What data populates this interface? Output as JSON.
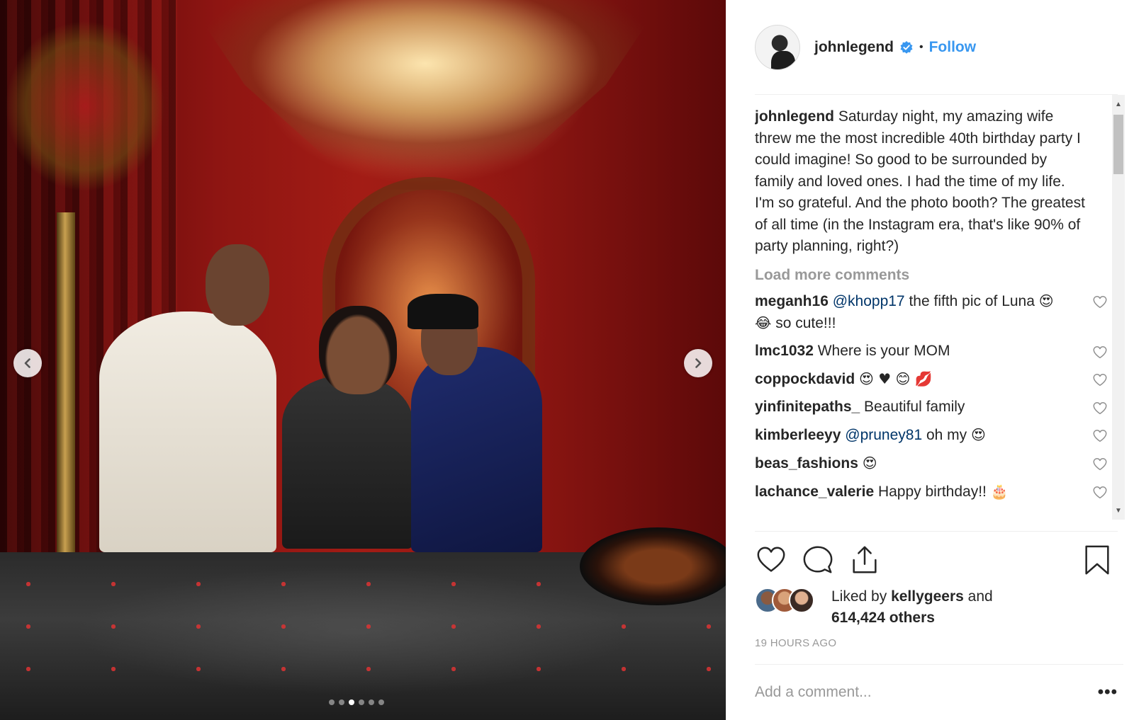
{
  "post": {
    "username": "johnlegend",
    "separator": "•",
    "follow_label": "Follow",
    "caption": "Saturday night, my amazing wife threw me the most incredible 40th birthday party I could imagine! So good to be surrounded by family and loved ones. I had the time of my life. I'm so grateful. And the photo booth? The greatest of all time (in the Instagram era, that's like 90% of party planning, right?)",
    "load_more": "Load more comments",
    "comments": [
      {
        "user": "meganh16",
        "mention": "@khopp17",
        "text": " the fifth pic of Luna ",
        "emoji": "😍 😂",
        "tail": " so cute!!!"
      },
      {
        "user": "lmc1032",
        "mention": "",
        "text": " Where is your MOM",
        "emoji": "",
        "tail": ""
      },
      {
        "user": "coppockdavid",
        "mention": "",
        "text": " ",
        "emoji": "😍 ♥ 😊 💋",
        "tail": ""
      },
      {
        "user": "yinfinitepaths_",
        "mention": "",
        "text": " Beautiful family",
        "emoji": "",
        "tail": ""
      },
      {
        "user": "kimberleeyy",
        "mention": "@pruney81",
        "text": " oh my ",
        "emoji": "😍",
        "tail": ""
      },
      {
        "user": "beas_fashions",
        "mention": "",
        "text": " ",
        "emoji": "😍",
        "tail": ""
      },
      {
        "user": "lachance_valerie",
        "mention": "",
        "text": " Happy birthday!! ",
        "emoji": "🎂",
        "tail": ""
      }
    ],
    "liked_by_prefix": "Liked by ",
    "liked_by_user": "kellygeers",
    "liked_by_and": " and",
    "others_count": "614,424 others",
    "timestamp": "19 HOURS AGO",
    "comment_placeholder": "Add a comment...",
    "more_label": "•••"
  },
  "carousel": {
    "slide_count": 6,
    "active_index": 2
  },
  "icons": {
    "verified": "verified-badge-icon",
    "prev": "chevron-left-icon",
    "next": "chevron-right-icon",
    "like": "heart-icon",
    "comment": "comment-bubble-icon",
    "share": "share-icon",
    "save": "bookmark-icon"
  },
  "colors": {
    "link_blue": "#3897f0",
    "mention_blue": "#003569",
    "muted_gray": "#999999",
    "text": "#262626"
  }
}
